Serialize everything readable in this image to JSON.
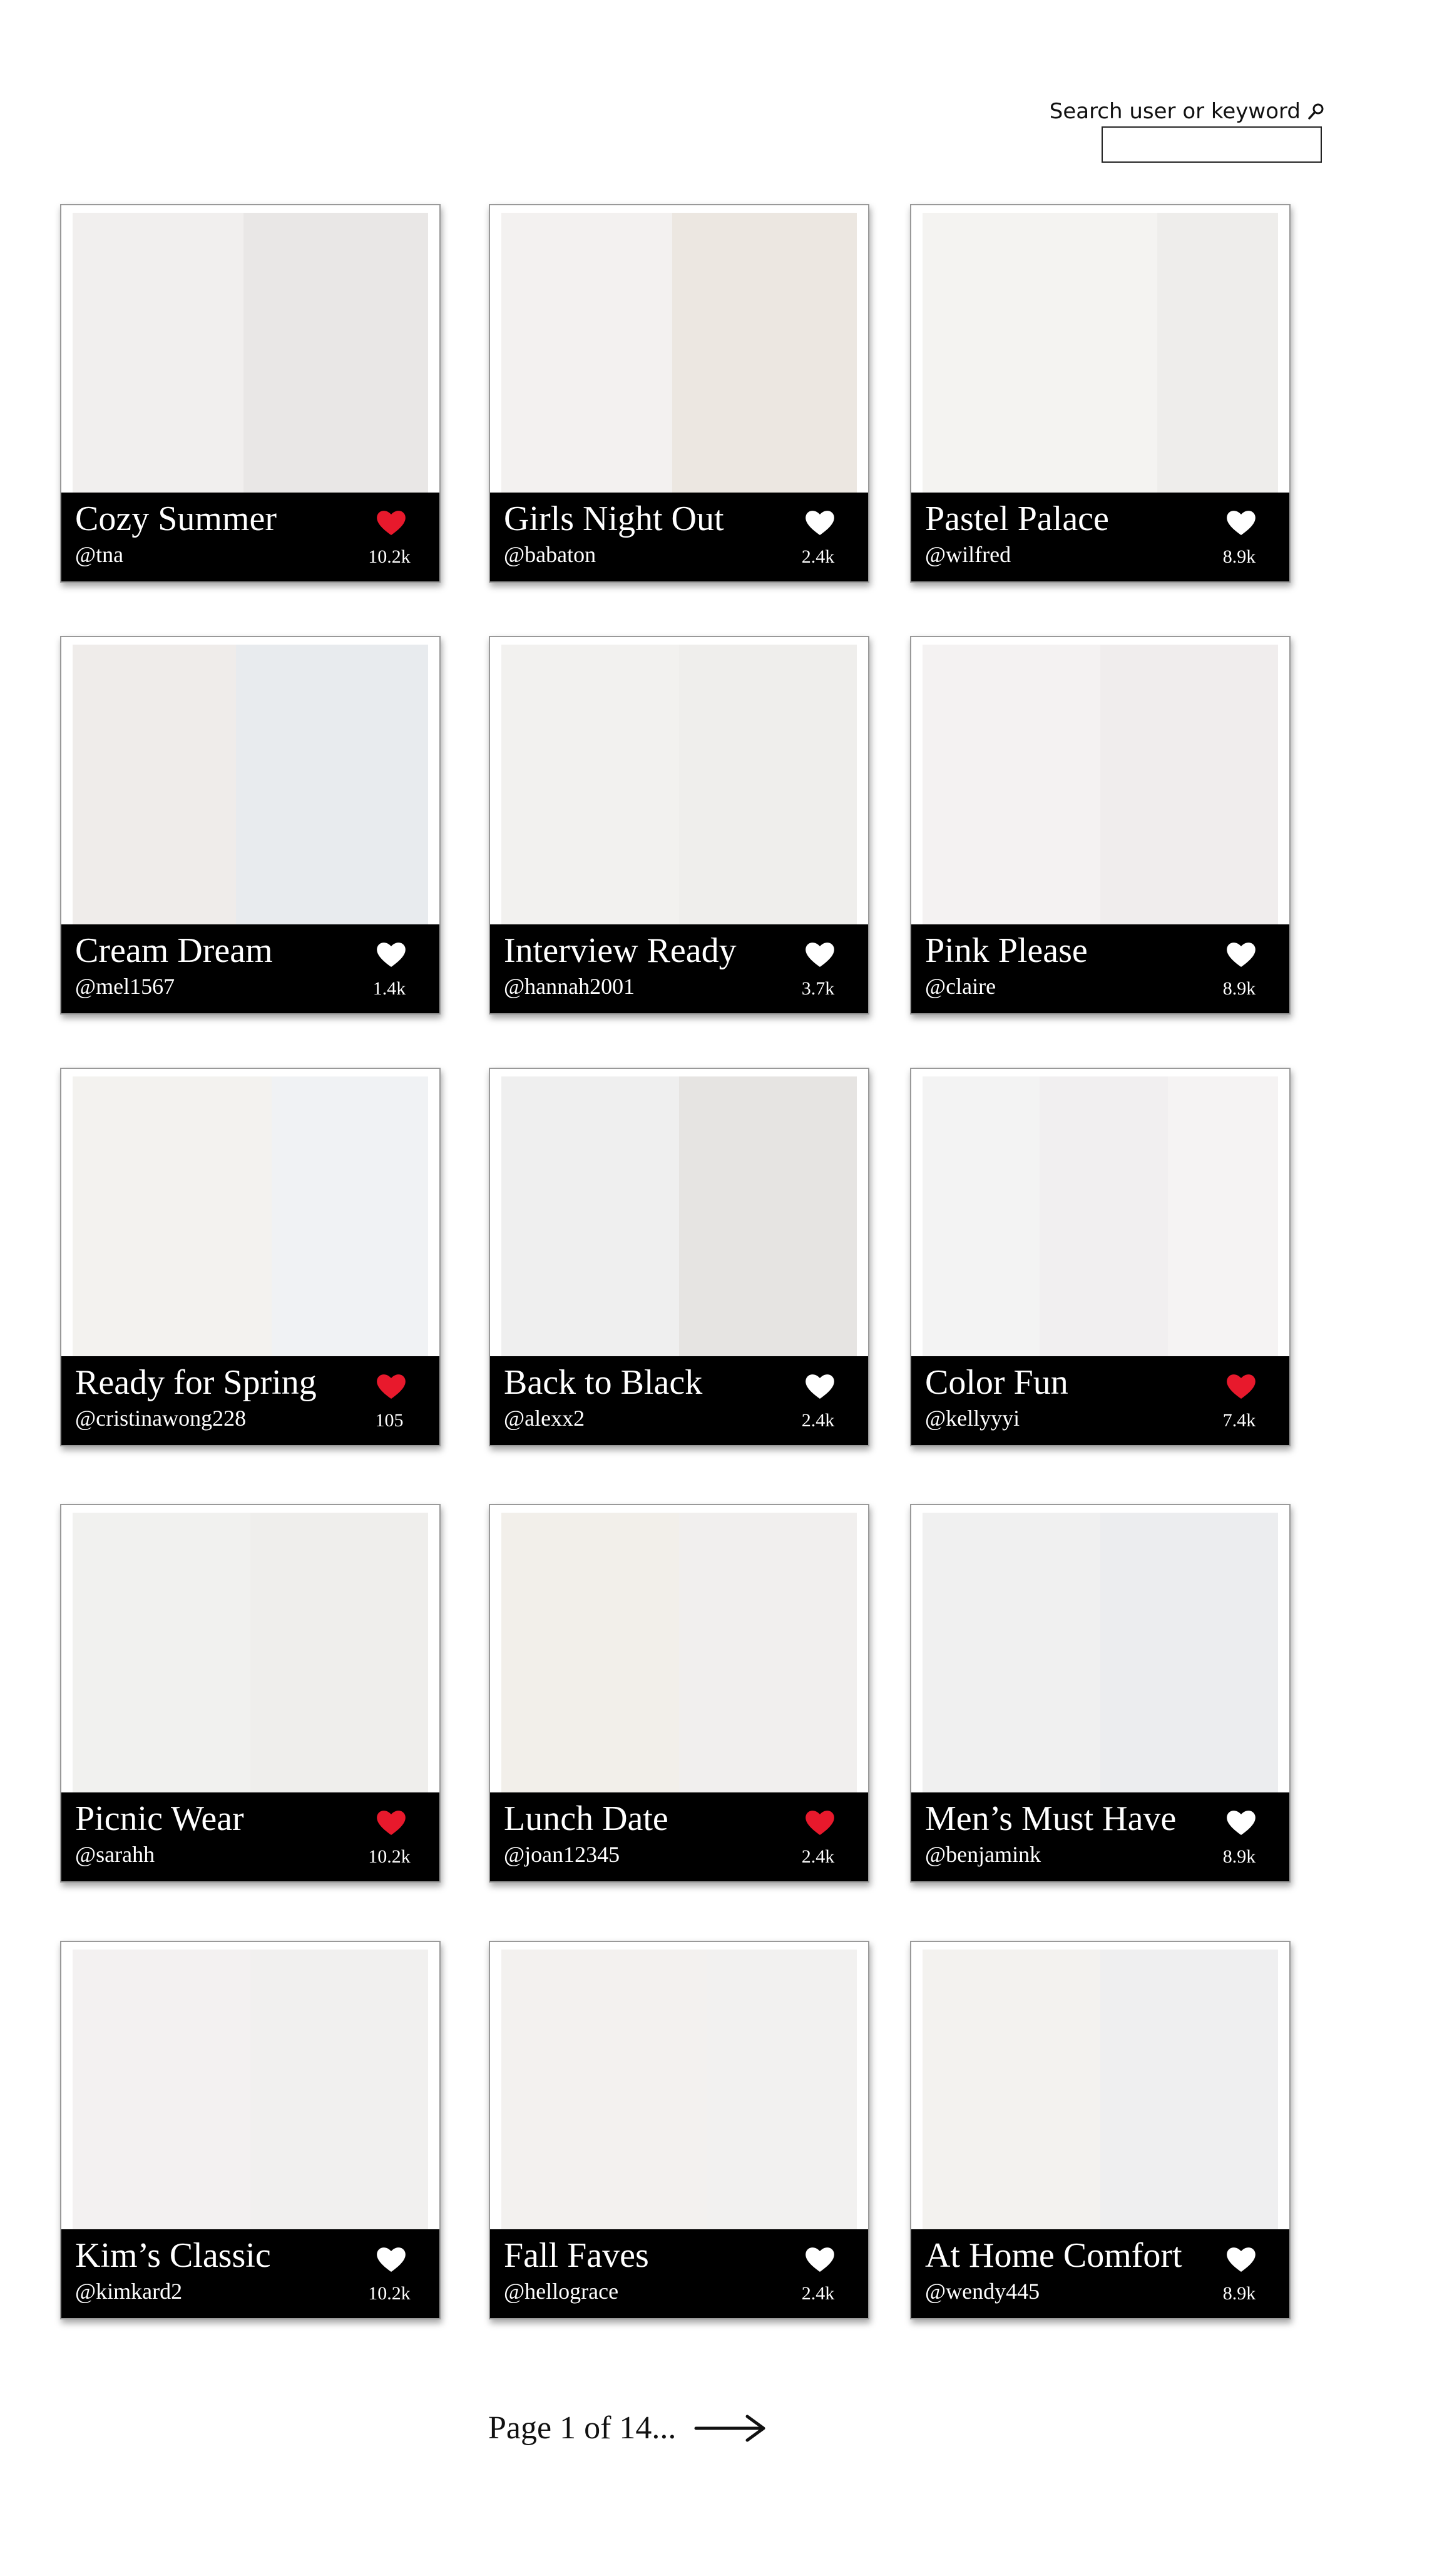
{
  "search": {
    "label": "Search user or keyword",
    "value": ""
  },
  "cards": [
    {
      "title": "Cozy Summer",
      "user": "@tna",
      "likes": "10.2k",
      "liked": true
    },
    {
      "title": "Girls Night Out",
      "user": "@babaton",
      "likes": "2.4k",
      "liked": false
    },
    {
      "title": "Pastel Palace",
      "user": "@wilfred",
      "likes": "8.9k",
      "liked": false
    },
    {
      "title": "Cream Dream",
      "user": "@mel1567",
      "likes": "1.4k",
      "liked": false
    },
    {
      "title": "Interview Ready",
      "user": "@hannah2001",
      "likes": "3.7k",
      "liked": false
    },
    {
      "title": "Pink Please",
      "user": "@claire",
      "likes": "8.9k",
      "liked": false
    },
    {
      "title": "Ready for Spring",
      "user": "@cristinawong228",
      "likes": "105",
      "liked": true
    },
    {
      "title": "Back to Black",
      "user": "@alexx2",
      "likes": "2.4k",
      "liked": false
    },
    {
      "title": "Color Fun",
      "user": "@kellyyyi",
      "likes": "7.4k",
      "liked": true
    },
    {
      "title": "Picnic Wear",
      "user": "@sarahh",
      "likes": "10.2k",
      "liked": true
    },
    {
      "title": "Lunch Date",
      "user": "@joan12345",
      "likes": "2.4k",
      "liked": true
    },
    {
      "title": "Men’s Must Have",
      "user": "@benjamink",
      "likes": "8.9k",
      "liked": false
    },
    {
      "title": "Kim’s Classic",
      "user": "@kimkard2",
      "likes": "10.2k",
      "liked": false
    },
    {
      "title": "Fall Faves",
      "user": "@hellograce",
      "likes": "2.4k",
      "liked": false
    },
    {
      "title": "At Home Comfort",
      "user": "@wendy445",
      "likes": "8.9k",
      "liked": false
    }
  ],
  "pagination": {
    "label": "Page 1 of 14..."
  },
  "colors": {
    "liked": "#e8192c",
    "unliked": "#ffffff",
    "footer": "#000000",
    "accent_text": "#ffffff"
  },
  "icons": {
    "search": "magnifier-icon",
    "like": "heart-icon",
    "next": "right-arrow-icon"
  }
}
